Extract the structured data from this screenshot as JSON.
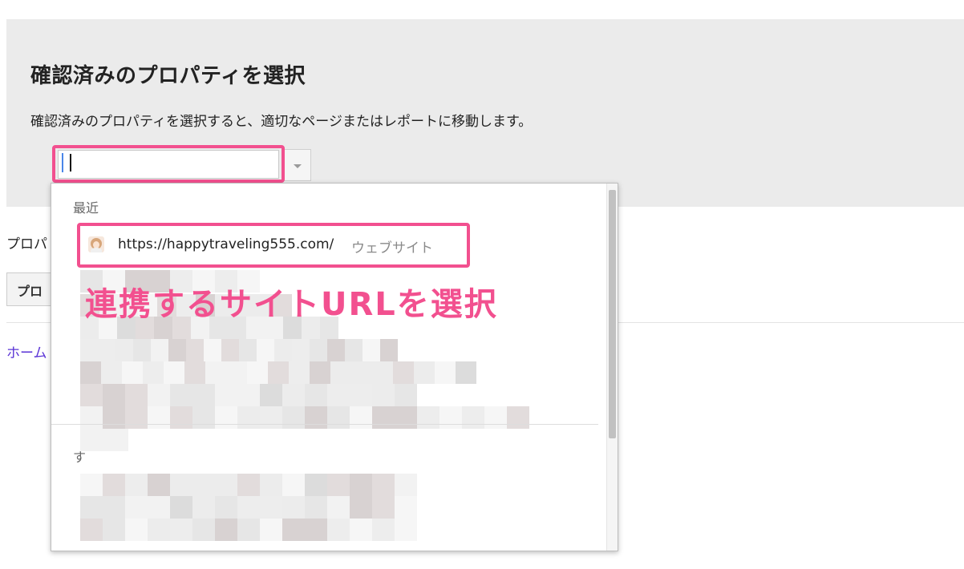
{
  "header": {
    "title": "確認済みのプロパティを選択",
    "description": "確認済みのプロパティを選択すると、適切なページまたはレポートに移動します。"
  },
  "property_select": {
    "value": "",
    "dropdown_icon": "triangle-down-icon"
  },
  "background_page": {
    "label_partial": "プロパ",
    "button_partial": "プロ",
    "home_link_partial": "ホーム"
  },
  "dropdown": {
    "recent_label": "最近",
    "recent_items": [
      {
        "url": "https://happytraveling555.com/",
        "type": "ウェブサイト",
        "icon": "user-avatar-favicon"
      }
    ],
    "all_label_partial": "す"
  },
  "annotation": {
    "text": "連携するサイトURLを選択",
    "color": "#f2508f"
  },
  "colors": {
    "highlight": "#f2508f",
    "panel_background": "#ebebeb",
    "link": "#5a33d6"
  }
}
